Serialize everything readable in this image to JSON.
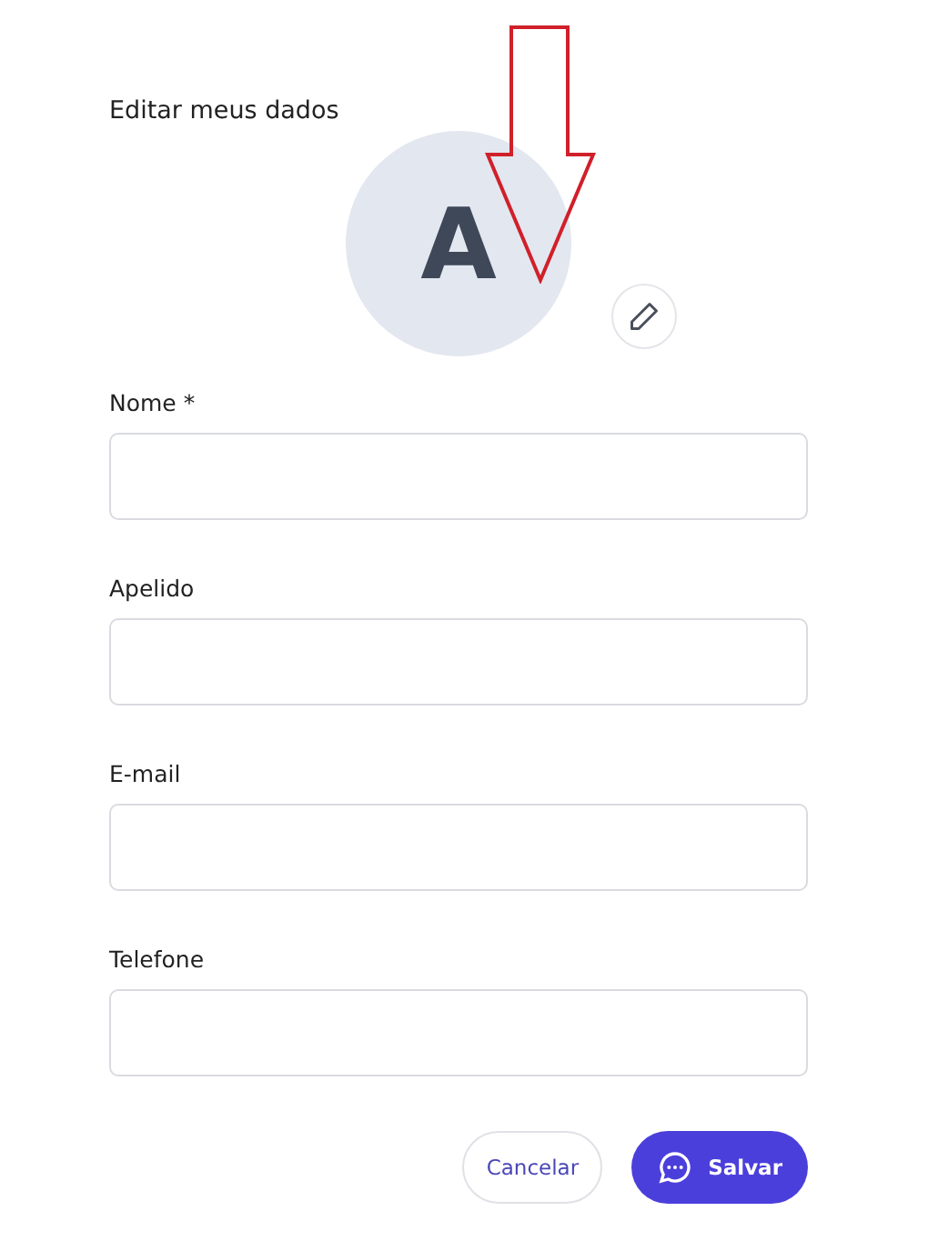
{
  "title": "Editar meus dados",
  "avatar": {
    "initial": "A"
  },
  "fields": [
    {
      "label": "Nome *"
    },
    {
      "label": "Apelido"
    },
    {
      "label": "E-mail"
    },
    {
      "label": "Telefone"
    }
  ],
  "buttons": [
    {
      "label": "Cancelar",
      "kind": "secondary"
    },
    {
      "label": "Salvar",
      "kind": "primary"
    }
  ]
}
